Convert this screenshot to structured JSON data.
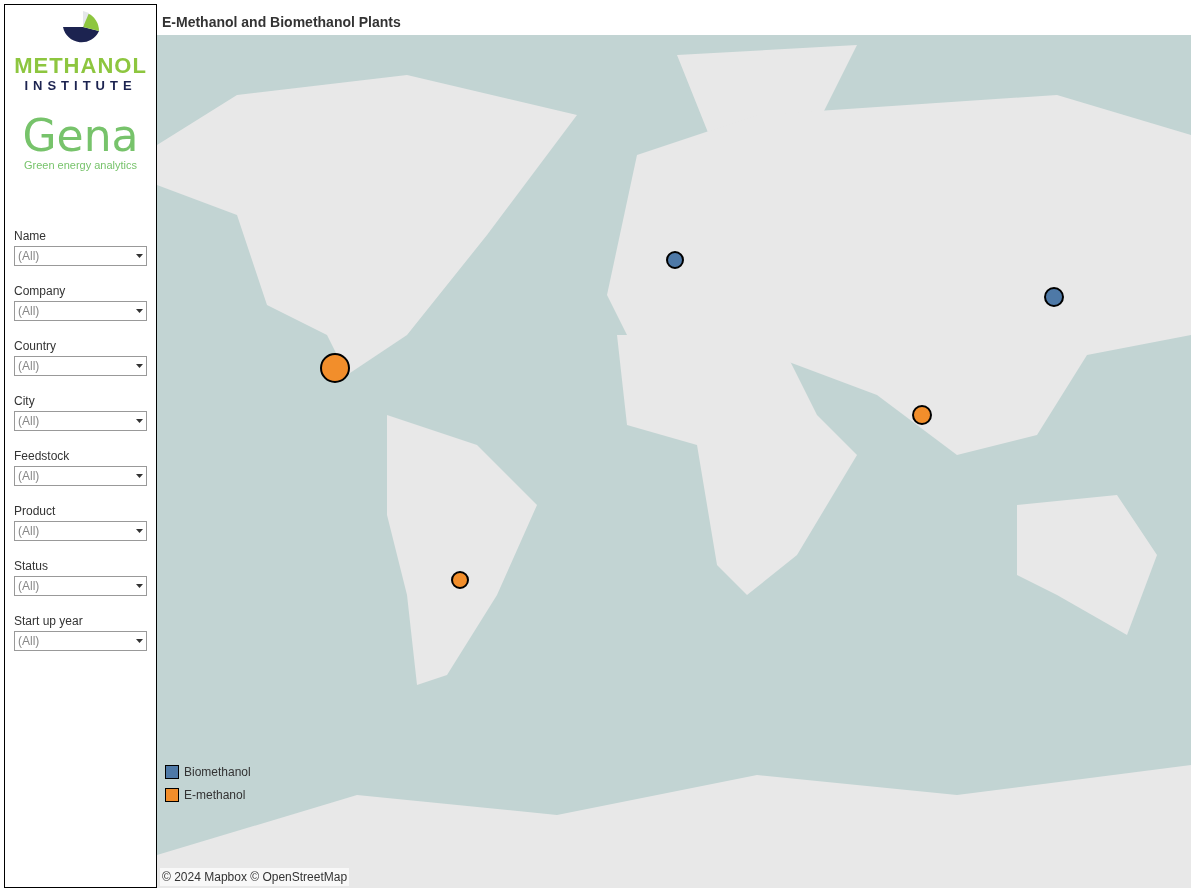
{
  "sidebar": {
    "logo": {
      "line_1": "METHANOL",
      "line_2": "INSTITUTE"
    },
    "brand": {
      "name": "Gena",
      "tagline": "Green energy analytics"
    },
    "filters": [
      {
        "label": "Name",
        "value": "(All)"
      },
      {
        "label": "Company",
        "value": "(All)"
      },
      {
        "label": "Country",
        "value": "(All)"
      },
      {
        "label": "City",
        "value": "(All)"
      },
      {
        "label": "Feedstock",
        "value": "(All)"
      },
      {
        "label": "Product",
        "value": "(All)"
      },
      {
        "label": "Status",
        "value": "(All)"
      },
      {
        "label": "Start up year",
        "value": "(All)"
      }
    ]
  },
  "title": "E-Methanol and Biomethanol Plants",
  "map": {
    "legend": [
      {
        "label": "Biomethanol",
        "color": "#4e79a7"
      },
      {
        "label": "E-methanol",
        "color": "#f28e2b"
      }
    ],
    "attribution": "© 2024 Mapbox © OpenStreetMap"
  }
}
